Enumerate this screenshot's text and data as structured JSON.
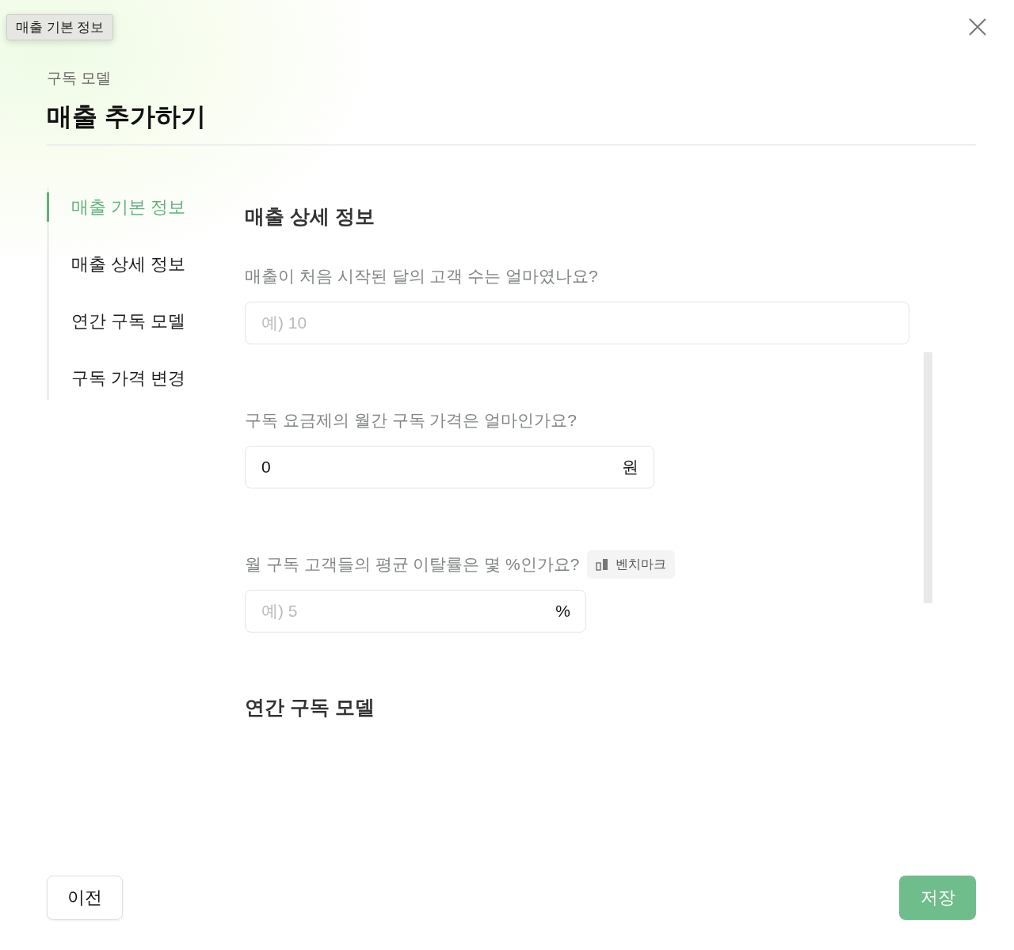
{
  "tooltip": "매출 기본 정보",
  "breadcrumb": "구독 모델",
  "title": "매출 추가하기",
  "nav": [
    {
      "label": "매출 기본 정보",
      "selected": true
    },
    {
      "label": "매출 상세 정보",
      "selected": false
    },
    {
      "label": "연간 구독 모델",
      "selected": false
    },
    {
      "label": "구독 가격 변경",
      "selected": false
    }
  ],
  "sections": [
    {
      "title": "매출 상세 정보",
      "questions": [
        {
          "label": "매출이 처음 시작된 달의 고객 수는 얼마였나요?",
          "placeholder": "예) 10"
        },
        {
          "label": "구독 요금제의 월간 구독 가격은 얼마인가요?",
          "value": "0",
          "unit": "원"
        },
        {
          "label": "월 구독 고객들의 평균 이탈률은 몇 %인가요?",
          "badge": "벤치마크",
          "placeholder": "예) 5",
          "unit": "%"
        }
      ]
    },
    {
      "title": "연간 구독 모델"
    }
  ],
  "buttons": {
    "previous": "이전",
    "save": "저장"
  }
}
